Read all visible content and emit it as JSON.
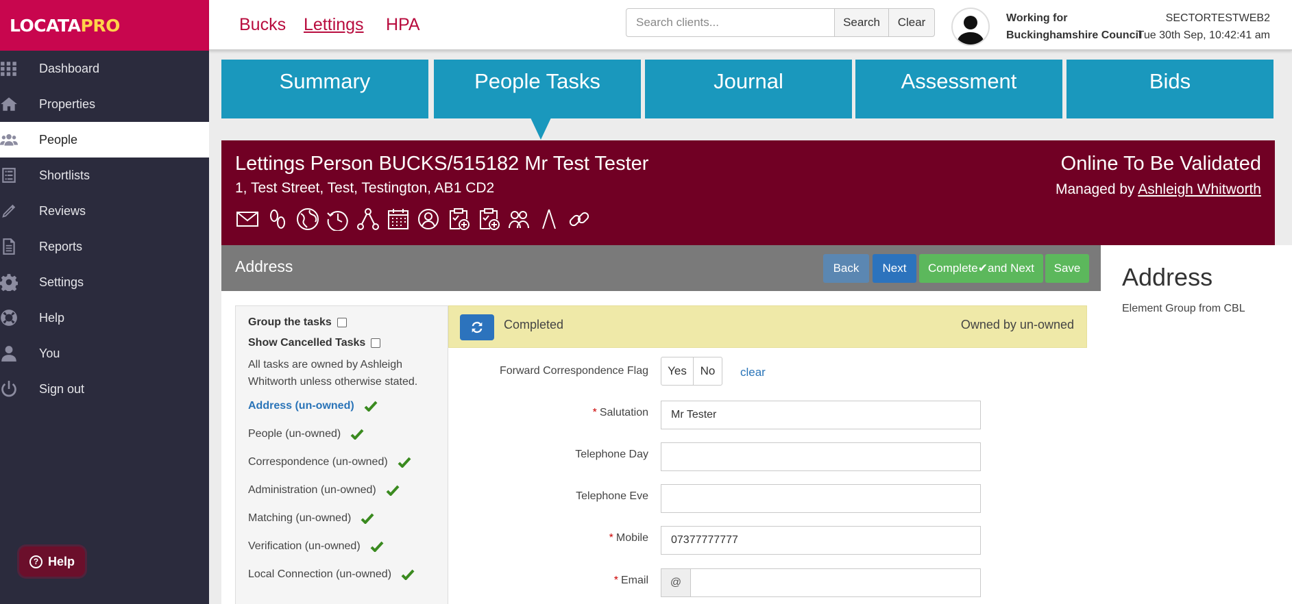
{
  "brand": {
    "logo_part1": "LOCATA",
    "logo_part2": "PRO",
    "accent": "#c8064e"
  },
  "sidebar": {
    "items": [
      {
        "label": "Dashboard",
        "icon": "grid-icon"
      },
      {
        "label": "Properties",
        "icon": "house-icon"
      },
      {
        "label": "People",
        "icon": "people-icon",
        "active": true
      },
      {
        "label": "Shortlists",
        "icon": "list-icon"
      },
      {
        "label": "Reviews",
        "icon": "pencil-icon"
      },
      {
        "label": "Reports",
        "icon": "document-icon"
      },
      {
        "label": "Settings",
        "icon": "gear-icon"
      },
      {
        "label": "Help",
        "icon": "lifebuoy-icon"
      },
      {
        "label": "You",
        "icon": "user-icon"
      },
      {
        "label": "Sign out",
        "icon": "power-icon"
      }
    ],
    "help_button": "Help"
  },
  "topbar": {
    "links": [
      "Bucks",
      "Lettings",
      "HPA"
    ],
    "search_placeholder": "Search clients...",
    "search_button": "Search",
    "clear_button": "Clear",
    "working_for_label": "Working for",
    "working_for_org": "Buckinghamshire Council",
    "environment": "SECTORTESTWEB2",
    "datetime": "Tue 30th Sep, 10:42:41 am"
  },
  "tabs": [
    "Summary",
    "People Tasks",
    "Journal",
    "Assessment",
    "Bids"
  ],
  "person": {
    "title": "Lettings Person BUCKS/515182 Mr Test Tester",
    "address": "1, Test Street, Test, Testington, AB1 CD2",
    "status": "Online To Be Validated",
    "managed_by_label": "Managed by",
    "managed_by_name": "Ashleigh Whitworth",
    "icons": [
      "envelope-icon",
      "footsteps-icon",
      "globe-icon",
      "history-icon",
      "network-icon",
      "calendar-icon",
      "user-circle-icon",
      "clipboard-add-icon",
      "clipboard-check-icon",
      "group-icon",
      "walk-icon",
      "link-icon"
    ]
  },
  "section": {
    "title": "Address",
    "buttons": {
      "back": "Back",
      "next": "Next",
      "complete_next": "Complete",
      "complete_next_suffix": "and Next",
      "save": "Save"
    }
  },
  "tasks": {
    "group_label": "Group the tasks",
    "cancelled_label": "Show Cancelled Tasks",
    "owned_note": "All tasks are owned by Ashleigh Whitworth unless otherwise stated.",
    "items": [
      "Address (un-owned)",
      "People (un-owned)",
      "Correspondence (un-owned)",
      "Administration (un-owned)",
      "Matching (un-owned)",
      "Verification (un-owned)",
      "Local Connection (un-owned)"
    ]
  },
  "status_bar": {
    "text": "Completed",
    "owned": "Owned by un-owned"
  },
  "form": {
    "forward_label": "Forward Correspondence Flag",
    "yes": "Yes",
    "no": "No",
    "clear": "clear",
    "salutation_label": "Salutation",
    "salutation_value": "Mr Tester",
    "tel_day_label": "Telephone Day",
    "tel_eve_label": "Telephone Eve",
    "mobile_label": "Mobile",
    "mobile_value": "07377777777",
    "email_label": "Email",
    "email_prefix": "@",
    "required_mark": "*"
  },
  "info": {
    "title": "Address",
    "subtitle": "Element Group from CBL"
  }
}
